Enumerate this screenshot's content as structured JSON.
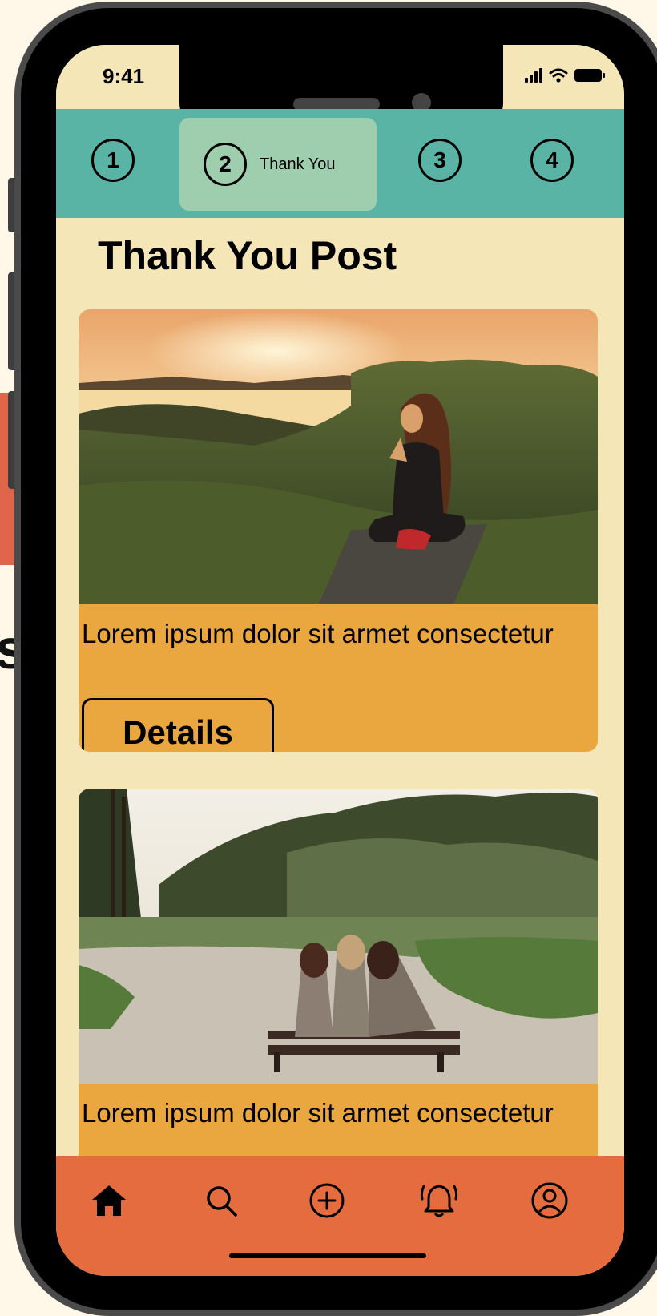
{
  "status_bar": {
    "time": "9:41"
  },
  "stepper": {
    "steps": [
      {
        "number": "1"
      },
      {
        "number": "2",
        "label": "Thank You",
        "active": true
      },
      {
        "number": "3"
      },
      {
        "number": "4"
      }
    ]
  },
  "page": {
    "title": "Thank You Post"
  },
  "posts": [
    {
      "image": "woman-meditating-on-yoga-mat-at-sunset-photo",
      "text": "Lorem ipsum dolor sit armet consectetur",
      "button_label": "Details"
    },
    {
      "image": "three-friends-on-bench-in-park-photo",
      "text": "Lorem ipsum dolor sit armet consectetur"
    }
  ],
  "background": {
    "partial_letter": "s"
  },
  "bottom_nav": {
    "items": [
      {
        "icon": "home-icon",
        "active": true
      },
      {
        "icon": "search-icon"
      },
      {
        "icon": "add-circle-icon"
      },
      {
        "icon": "bell-ringing-icon"
      },
      {
        "icon": "profile-icon"
      }
    ]
  },
  "colors": {
    "screen_bg": "#F4E6B6",
    "stepper_bg": "#5AB4A5",
    "stepper_active": "#9ECEAD",
    "card_bg": "#EBA73F",
    "nav_bg": "#E56C3F",
    "accent_coral": "#E0654A",
    "page_bg": "#FFF8E9"
  }
}
